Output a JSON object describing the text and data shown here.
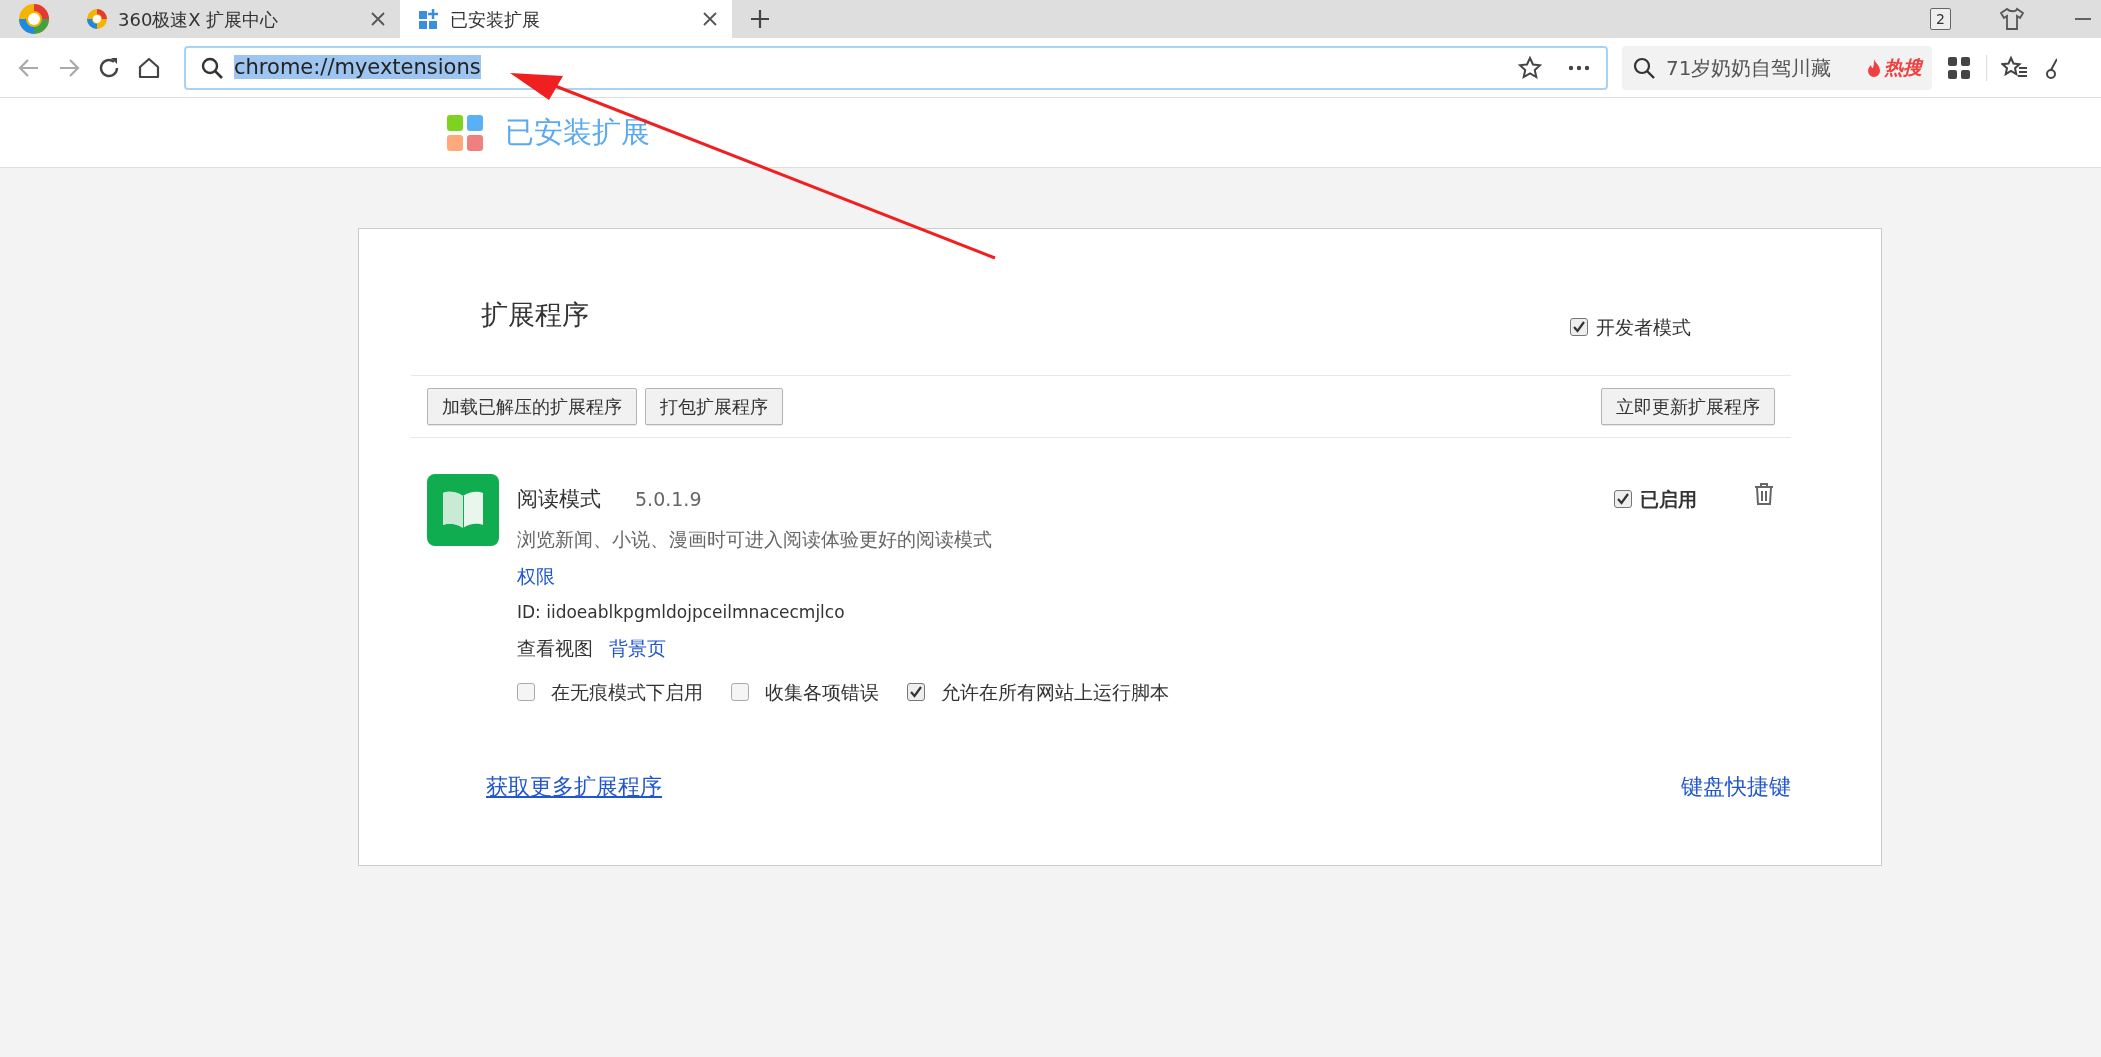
{
  "browser": {
    "tabs": [
      {
        "title": "360极速X 扩展中心",
        "selected": false
      },
      {
        "title": "已安装扩展",
        "selected": true
      }
    ],
    "window_count": "2",
    "address": {
      "text": "chrome://myextensions",
      "selected": true
    },
    "hot_search": {
      "text": "71岁奶奶自驾川藏",
      "badge": "热搜"
    }
  },
  "page": {
    "header_title": "已安装扩展",
    "section_title": "扩展程序",
    "developer_mode": {
      "label": "开发者模式",
      "checked": true
    },
    "buttons": [
      "加载已解压的扩展程序",
      "打包扩展程序"
    ],
    "update_button": "立即更新扩展程序",
    "extensions": [
      {
        "name": "阅读模式",
        "version": "5.0.1.9",
        "description": "浏览新闻、小说、漫画时可进入阅读体验更好的阅读模式",
        "permissions_link": "权限",
        "id": "ID: iidoeablkpgmldojpceilmnacecmjlco",
        "views_label": "查看视图",
        "views_link": "背景页",
        "enabled": {
          "label": "已启用",
          "checked": true
        },
        "options": [
          {
            "label": "在无痕模式下启用",
            "checked": false
          },
          {
            "label": "收集各项错误",
            "checked": false
          },
          {
            "label": "允许在所有网站上运行脚本",
            "checked": true
          }
        ]
      }
    ],
    "footer_links": [
      "获取更多扩展程序",
      "键盘快捷键"
    ]
  }
}
